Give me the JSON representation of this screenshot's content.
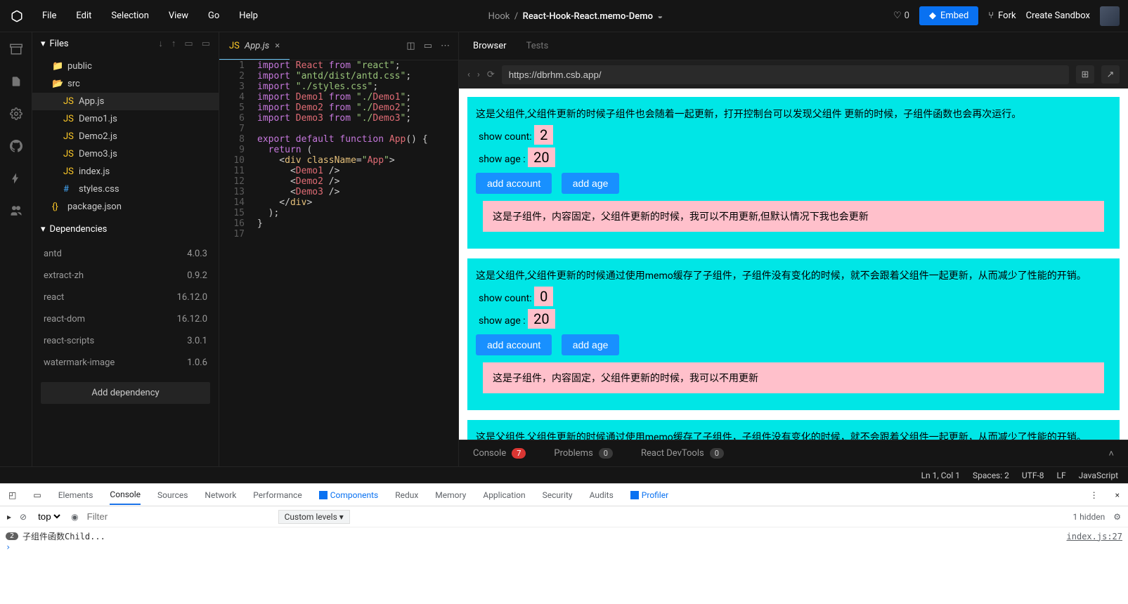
{
  "menu": {
    "file": "File",
    "edit": "Edit",
    "selection": "Selection",
    "view": "View",
    "go": "Go",
    "help": "Help"
  },
  "breadcrumb": {
    "parent": "Hook",
    "sep": "/",
    "title": "React-Hook-React.memo-Demo"
  },
  "topbar": {
    "likes": "0",
    "embed": "Embed",
    "fork": "Fork",
    "create": "Create Sandbox"
  },
  "sidebar": {
    "files_label": "Files",
    "tree": {
      "public": "public",
      "src": "src",
      "items": [
        "App.js",
        "Demo1.js",
        "Demo2.js",
        "Demo3.js",
        "index.js",
        "styles.css"
      ],
      "package": "package.json"
    },
    "deps_label": "Dependencies",
    "deps": [
      {
        "name": "antd",
        "ver": "4.0.3"
      },
      {
        "name": "extract-zh",
        "ver": "0.9.2"
      },
      {
        "name": "react",
        "ver": "16.12.0"
      },
      {
        "name": "react-dom",
        "ver": "16.12.0"
      },
      {
        "name": "react-scripts",
        "ver": "3.0.1"
      },
      {
        "name": "watermark-image",
        "ver": "1.0.6"
      }
    ],
    "add_dep": "Add dependency"
  },
  "editor": {
    "active_file": "App.js",
    "lines": [
      "import React from \"react\";",
      "import \"antd/dist/antd.css\";",
      "import \"./styles.css\";",
      "import Demo1 from \"./Demo1\";",
      "import Demo2 from \"./Demo2\";",
      "import Demo3 from \"./Demo3\";",
      "",
      "export default function App() {",
      "  return (",
      "    <div className=\"App\">",
      "      <Demo1 />",
      "      <Demo2 />",
      "      <Demo3 />",
      "    </div>",
      "  );",
      "}",
      ""
    ]
  },
  "preview_tabs": {
    "browser": "Browser",
    "tests": "Tests"
  },
  "address": "https://dbrhm.csb.app/",
  "preview": {
    "demo1": {
      "desc": "这是父组件,父组件更新的时候子组件也会随着一起更新，打开控制台可以发现父组件 更新的时候，子组件函数也会再次运行。",
      "count_label": "show count:",
      "count": "2",
      "age_label": "show age :",
      "age": "20",
      "btn1": "add account",
      "btn2": "add age",
      "child": "这是子组件，内容固定，父组件更新的时候，我可以不用更新,但默认情况下我也会更新"
    },
    "demo2": {
      "desc": "这是父组件,父组件更新的时候通过使用memo缓存了子组件，子组件没有变化的时候，就不会跟着父组件一起更新，从而减少了性能的开销。",
      "count_label": "show count:",
      "count": "0",
      "age_label": "show age :",
      "age": "20",
      "btn1": "add account",
      "btn2": "add age",
      "child": "这是子组件，内容固定，父组件更新的时候，我可以不用更新"
    },
    "demo3": {
      "desc": "这是父组件,父组件更新的时候通过使用memo缓存了子组件，子组件没有变化的时候，就不会跟着父组件一起更新，从而减少了性能的开销。"
    }
  },
  "console_tabs": {
    "console": "Console",
    "console_badge": "7",
    "problems": "Problems",
    "problems_badge": "0",
    "rdt": "React DevTools",
    "rdt_badge": "0"
  },
  "status": {
    "pos": "Ln 1, Col 1",
    "spaces": "Spaces: 2",
    "enc": "UTF-8",
    "eol": "LF",
    "lang": "JavaScript"
  },
  "devtools": {
    "tabs": [
      "Elements",
      "Console",
      "Sources",
      "Network",
      "Performance",
      "Components",
      "Redux",
      "Memory",
      "Application",
      "Security",
      "Audits",
      "Profiler"
    ],
    "active_tab": "Console",
    "context": "top",
    "filter_placeholder": "Filter",
    "levels": "Custom levels",
    "hidden": "1 hidden",
    "log_count": "2",
    "log_msg": "子组件函数Child...",
    "log_src": "index.js:27"
  }
}
